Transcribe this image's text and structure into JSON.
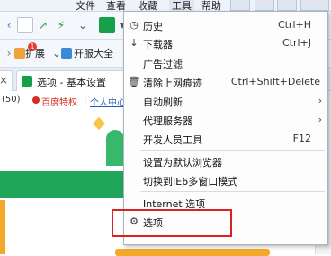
{
  "menubar": {
    "file": "文件",
    "view": "查看",
    "favorites": "收藏",
    "tools": "工具",
    "help": "帮助"
  },
  "favbar": {
    "extensions": "扩展",
    "badge": "1",
    "dev": "开服大全"
  },
  "tab": {
    "label": "选项 - 基本设置"
  },
  "linkbar": {
    "count": "(50)",
    "baidu": "百度特权",
    "personal": "个人中心"
  },
  "menu": {
    "items": [
      {
        "icon": "clock-icon",
        "label": "历史",
        "shortcut": "Ctrl+H"
      },
      {
        "icon": "download-icon",
        "label": "下载器",
        "shortcut": "Ctrl+J"
      },
      {
        "icon": "",
        "label": "广告过滤",
        "shortcut": ""
      },
      {
        "icon": "trash-icon",
        "label": "清除上网痕迹",
        "shortcut": "Ctrl+Shift+Delete"
      },
      {
        "icon": "",
        "label": "自动刷新",
        "shortcut": ""
      },
      {
        "icon": "",
        "label": "代理服务器",
        "shortcut": ""
      },
      {
        "icon": "",
        "label": "开发人员工具",
        "shortcut": "F12"
      },
      {
        "icon": "",
        "label": "设置为默认浏览器",
        "shortcut": ""
      },
      {
        "icon": "",
        "label": "切换到IE6多窗口模式",
        "shortcut": ""
      },
      {
        "icon": "",
        "label": "Internet 选项",
        "shortcut": ""
      },
      {
        "icon": "gear-icon",
        "label": "选项",
        "shortcut": ""
      }
    ]
  },
  "colors": {
    "accent": "#16a04a",
    "highlight": "#e02020"
  }
}
